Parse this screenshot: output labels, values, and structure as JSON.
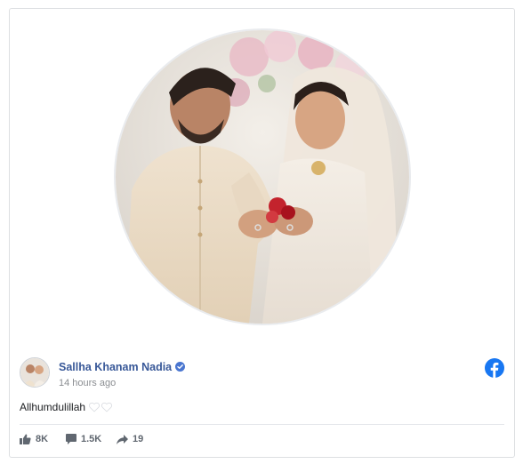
{
  "post": {
    "author": "Sallha Khanam Nadia",
    "time": "14 hours ago",
    "text": "Allhumdulillah",
    "photo_alt": "Couple in wedding attire showing rings"
  },
  "stats": {
    "likes": "8K",
    "comments": "1.5K",
    "shares": "19"
  },
  "icons": {
    "verified": "verified-badge-icon",
    "platform": "facebook-logo-icon",
    "like": "thumbs-up-icon",
    "comment": "comment-bubble-icon",
    "share": "share-arrow-icon"
  },
  "colors": {
    "author_link": "#385898",
    "verified": "#4a76d0",
    "facebook_blue": "#1877f2",
    "muted_text": "#606770"
  }
}
